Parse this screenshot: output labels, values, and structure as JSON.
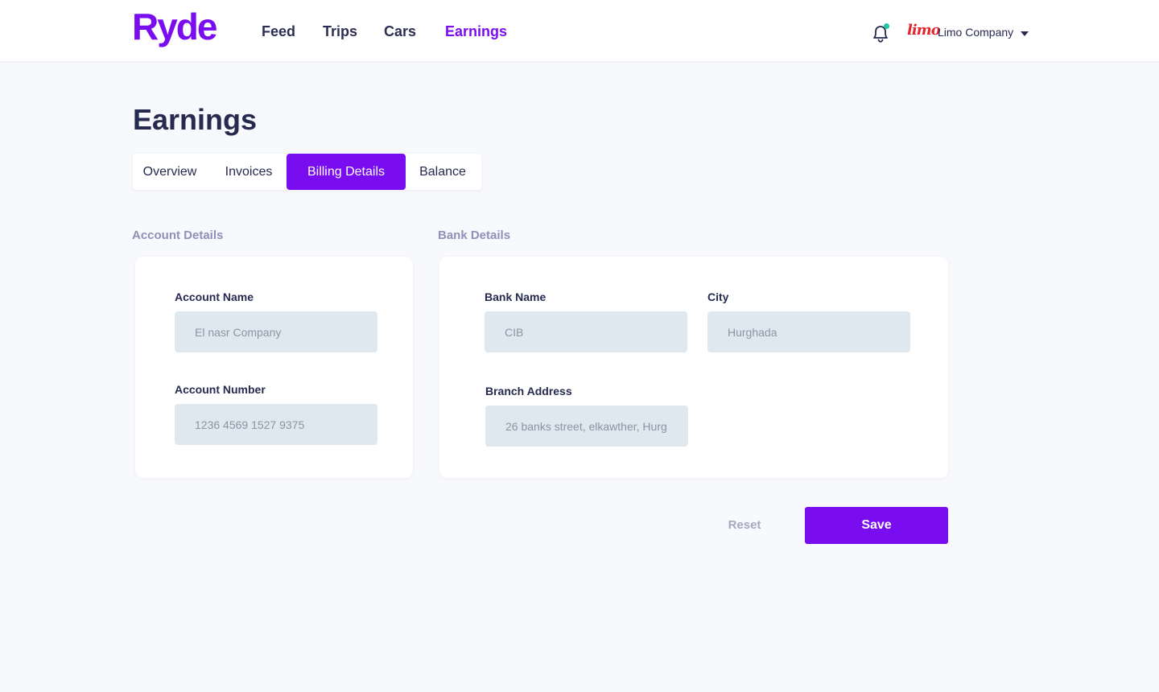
{
  "brand": {
    "name": "Ryde",
    "accent_color": "#7a0cf0"
  },
  "nav": {
    "items": [
      {
        "label": "Feed",
        "active": false
      },
      {
        "label": "Trips",
        "active": false
      },
      {
        "label": "Cars",
        "active": false
      },
      {
        "label": "Earnings",
        "active": true
      }
    ]
  },
  "header": {
    "notification_icon": "bell-icon",
    "notification_dot_color": "#20c4a6",
    "company_logo_text": "limo",
    "company_name": "Limo Company",
    "dropdown_icon": "caret-down-icon"
  },
  "page": {
    "title": "Earnings"
  },
  "tabs": [
    {
      "label": "Overview",
      "active": false
    },
    {
      "label": "Invoices",
      "active": false
    },
    {
      "label": "Billing Details",
      "active": true
    },
    {
      "label": "Balance",
      "active": false
    }
  ],
  "account_details": {
    "heading": "Account Details",
    "account_name": {
      "label": "Account Name",
      "value": "El nasr Company"
    },
    "account_number": {
      "label": "Account Number",
      "value": "1236 4569 1527 9375"
    }
  },
  "bank_details": {
    "heading": "Bank Details",
    "bank_name": {
      "label": "Bank Name",
      "value": "CIB"
    },
    "city": {
      "label": "City",
      "value": "Hurghada"
    },
    "branch_address": {
      "label": "Branch Address",
      "value": "26 banks street, elkawther, Hurg"
    }
  },
  "actions": {
    "reset_label": "Reset",
    "save_label": "Save"
  }
}
